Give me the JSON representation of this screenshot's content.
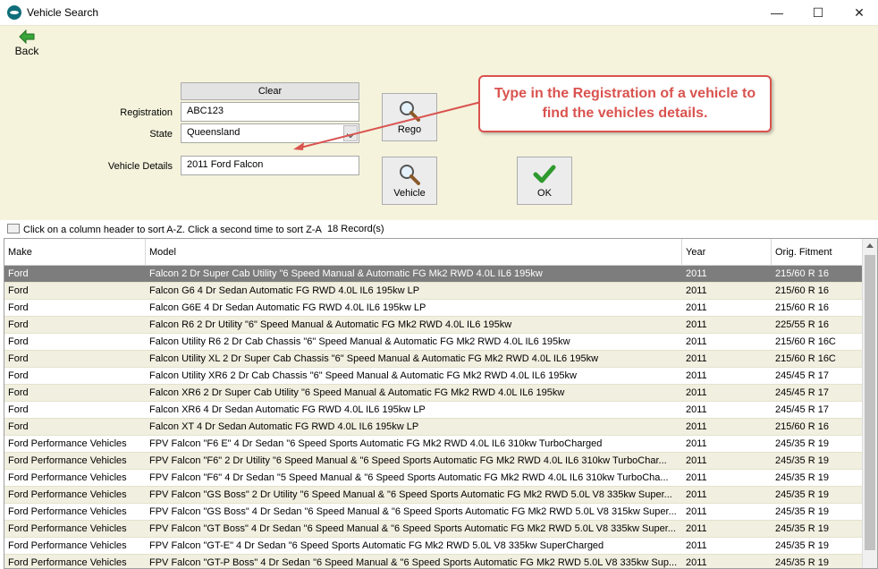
{
  "window": {
    "title": "Vehicle Search",
    "minimize": "—",
    "maximize": "☐",
    "close": "✕"
  },
  "toolbar": {
    "back_label": "Back"
  },
  "form": {
    "clear_label": "Clear",
    "registration_label": "Registration",
    "registration_value": "ABC123",
    "state_label": "State",
    "state_value": "Queensland",
    "vehicle_details_label": "Vehicle Details",
    "vehicle_details_value": "2011 Ford Falcon",
    "rego_button_label": "Rego",
    "vehicle_button_label": "Vehicle",
    "ok_button_label": "OK"
  },
  "callout": {
    "text": "Type in the Registration of a vehicle to find the vehicles details."
  },
  "grid_info": {
    "sort_hint": "Click on a column header to sort A-Z. Click a second time to sort Z-A",
    "record_count": "18 Record(s)"
  },
  "grid": {
    "columns": [
      "Make",
      "Model",
      "Year",
      "Orig. Fitment"
    ],
    "rows": [
      {
        "make": "Ford",
        "model": "Falcon 2 Dr Super Cab Utility \"6 Speed Manual & Automatic FG Mk2 RWD 4.0L IL6 195kw",
        "year": "2011",
        "fitment": "215/60 R 16"
      },
      {
        "make": "Ford",
        "model": "Falcon G6 4 Dr Sedan Automatic FG RWD 4.0L IL6 195kw LP",
        "year": "2011",
        "fitment": "215/60 R 16"
      },
      {
        "make": "Ford",
        "model": "Falcon G6E 4 Dr Sedan Automatic FG RWD 4.0L IL6 195kw LP",
        "year": "2011",
        "fitment": "215/60 R 16"
      },
      {
        "make": "Ford",
        "model": "Falcon R6 2 Dr Utility \"6\" Speed Manual & Automatic FG Mk2 RWD 4.0L IL6 195kw",
        "year": "2011",
        "fitment": "225/55 R 16"
      },
      {
        "make": "Ford",
        "model": "Falcon Utility R6 2 Dr Cab Chassis \"6\" Speed Manual & Automatic FG Mk2 RWD 4.0L IL6 195kw",
        "year": "2011",
        "fitment": "215/60 R 16C"
      },
      {
        "make": "Ford",
        "model": "Falcon Utility XL 2 Dr Super Cab Chassis \"6\" Speed Manual & Automatic FG Mk2 RWD 4.0L IL6 195kw",
        "year": "2011",
        "fitment": "215/60 R 16C"
      },
      {
        "make": "Ford",
        "model": "Falcon Utility XR6 2 Dr Cab Chassis \"6\" Speed Manual & Automatic FG Mk2 RWD 4.0L IL6 195kw",
        "year": "2011",
        "fitment": "245/45 R 17"
      },
      {
        "make": "Ford",
        "model": "Falcon XR6 2 Dr Super Cab Utility \"6 Speed Manual & Automatic FG Mk2 RWD 4.0L IL6 195kw",
        "year": "2011",
        "fitment": "245/45 R 17"
      },
      {
        "make": "Ford",
        "model": "Falcon XR6 4 Dr Sedan Automatic FG RWD 4.0L IL6 195kw LP",
        "year": "2011",
        "fitment": "245/45 R 17"
      },
      {
        "make": "Ford",
        "model": "Falcon XT 4 Dr Sedan Automatic FG RWD 4.0L IL6 195kw LP",
        "year": "2011",
        "fitment": "215/60 R 16"
      },
      {
        "make": "Ford Performance Vehicles",
        "model": "FPV Falcon \"F6 E\" 4 Dr Sedan \"6 Speed Sports Automatic FG Mk2 RWD 4.0L IL6 310kw TurboCharged",
        "year": "2011",
        "fitment": "245/35 R 19"
      },
      {
        "make": "Ford Performance Vehicles",
        "model": "FPV Falcon \"F6\" 2 Dr Utility \"6 Speed Manual & \"6 Speed Sports Automatic FG Mk2 RWD 4.0L IL6 310kw TurboChar...",
        "year": "2011",
        "fitment": "245/35 R 19"
      },
      {
        "make": "Ford Performance Vehicles",
        "model": "FPV Falcon \"F6\" 4 Dr Sedan \"5 Speed Manual & \"6 Speed Sports Automatic FG Mk2 RWD 4.0L IL6 310kw TurboCha...",
        "year": "2011",
        "fitment": "245/35 R 19"
      },
      {
        "make": "Ford Performance Vehicles",
        "model": "FPV Falcon \"GS Boss\" 2 Dr Utility \"6 Speed Manual & \"6 Speed Sports Automatic FG Mk2 RWD 5.0L V8 335kw Super...",
        "year": "2011",
        "fitment": "245/35 R 19"
      },
      {
        "make": "Ford Performance Vehicles",
        "model": "FPV Falcon \"GS Boss\" 4 Dr Sedan \"6 Speed Manual & \"6 Speed Sports Automatic FG Mk2 RWD 5.0L V8 315kw Super...",
        "year": "2011",
        "fitment": "245/35 R 19"
      },
      {
        "make": "Ford Performance Vehicles",
        "model": "FPV Falcon \"GT Boss\" 4 Dr Sedan \"6 Speed Manual & \"6 Speed Sports Automatic FG Mk2 RWD 5.0L V8 335kw Super...",
        "year": "2011",
        "fitment": "245/35 R 19"
      },
      {
        "make": "Ford Performance Vehicles",
        "model": "FPV Falcon \"GT-E\" 4 Dr Sedan \"6 Speed Sports Automatic FG Mk2 RWD 5.0L V8 335kw SuperCharged",
        "year": "2011",
        "fitment": "245/35 R 19"
      },
      {
        "make": "Ford Performance Vehicles",
        "model": "FPV Falcon \"GT-P Boss\" 4 Dr Sedan \"6 Speed Manual & \"6 Speed Sports Automatic FG Mk2 RWD 5.0L V8 335kw Sup...",
        "year": "2011",
        "fitment": "245/35 R 19"
      }
    ]
  }
}
